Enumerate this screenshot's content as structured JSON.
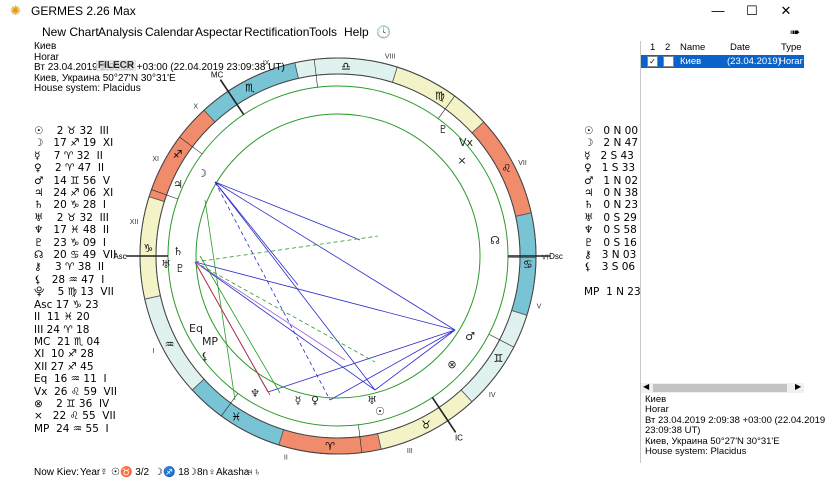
{
  "window": {
    "title": "GERMES 2.26 Max",
    "minimize": "—",
    "maximize": "☐",
    "close": "✕"
  },
  "menu": [
    "New Chart",
    "Analysis",
    "Calendar",
    "Aspectar",
    "Rectification",
    "Tools",
    "Help"
  ],
  "info": {
    "city": "Киев",
    "chart": "Horar",
    "date": "Вт 23.04.2019 2:09:38 +03:00 (22.04.2019 23:09:38 UT)",
    "place": "Киев, Украина 50°27'N 30°31'E",
    "house_system": "House system: Placidus",
    "watermark": "FILECR"
  },
  "planets": [
    "☉    2 ♉ 32  III",
    "☽   17 ♐ 19  XI",
    "☿    7 ♈ 32  II",
    "♀    2 ♈ 47  II",
    "♂   14 ♊ 56  V",
    "♃   24 ♐ 06  XI",
    "♄   20 ♑ 28  I",
    "♅    2 ♉ 32  III",
    "♆   17 ♓ 48  II",
    "♇   23 ♑ 09  I",
    "☊   20 ♋ 49  VII",
    "⚷    3 ♈ 38  II",
    "⚸   28 ♒ 47  I",
    "⯓    5 ♍ 13  VII",
    "Asc 17 ♑ 23",
    "II  11 ♓ 20",
    "III 24 ♈ 18",
    "MC  21 ♏ 04",
    "XI  10 ♐ 28",
    "XII 27 ♐ 45",
    "Eq  16 ♒ 11  I",
    "Vx  26 ♌ 59  VII",
    "⊗    2 ♊ 36  IV",
    "×   22 ♌ 55  VII",
    "MP  24 ♒ 55  I"
  ],
  "declinations": [
    "☉   0 N 00",
    "☽   2 N 47",
    "☿   2 S 43",
    "♀   1 S 33",
    "♂   1 N 02",
    "♃   0 N 38",
    "♄   0 N 23",
    "♅   0 S 29",
    "♆   0 S 58",
    "♇   0 S 16",
    "⚷   3 N 03",
    "⚸   3 S 06",
    "",
    "MP  1 N 23"
  ],
  "panel": {
    "headers": [
      "1",
      "2",
      "Name",
      "Date",
      "Type"
    ],
    "row": {
      "name": "Киев",
      "date": "(23.04.2019)",
      "type": "Horar"
    },
    "info": [
      "Киев",
      "Horar",
      "Вт 23.04.2019 2:09:38 +03:00 (22.04.2019",
      "23:09:38 UT)",
      "Киев, Украина 50°27'N 30°31'E",
      "House system: Placidus"
    ]
  },
  "status": {
    "now": "Now Kiev:",
    "year": "Year☿",
    "s1": "☉♉ 3/2",
    "s2": "☽♐ 18",
    "s3": "☽8n♀",
    "s4": "Akasha",
    "s5": "♃♄"
  },
  "wheel": {
    "signs": [
      "♈",
      "♉",
      "♊",
      "♋",
      "♌",
      "♍",
      "♎",
      "♏",
      "♐",
      "♑",
      "♒",
      "♓"
    ],
    "angle_labels": {
      "asc": "Asc",
      "dsc": "Dsc",
      "mc": "MC",
      "ic": "IC"
    },
    "house_numbers": [
      "I",
      "II",
      "III",
      "IV",
      "V",
      "VI",
      "VII",
      "VIII",
      "IX",
      "X",
      "XI",
      "XII"
    ]
  },
  "colors": {
    "fire": "#f08c6c",
    "earth": "#f4f3c8",
    "air": "#dff2f0",
    "water": "#79c4d4",
    "selection": "#0a63c8"
  }
}
